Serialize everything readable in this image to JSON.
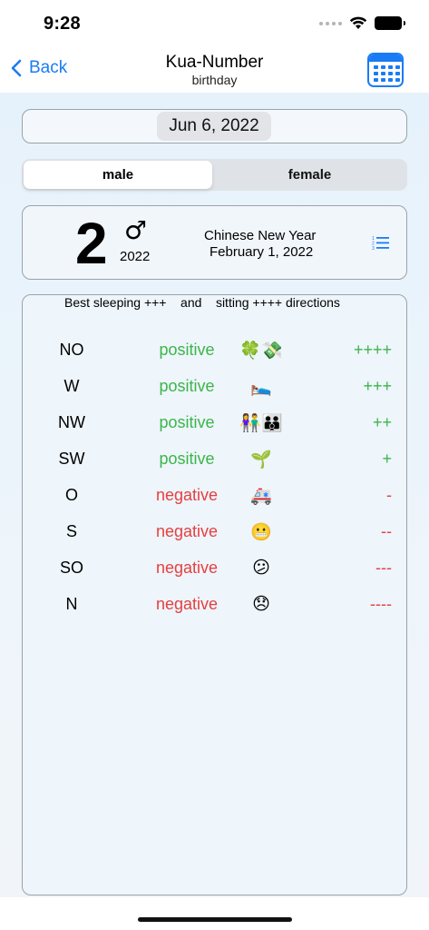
{
  "status": {
    "time": "9:28"
  },
  "nav": {
    "back_label": "Back",
    "title": "Kua-Number",
    "subtitle": "birthday"
  },
  "date_picker": {
    "value": "Jun 6, 2022"
  },
  "gender_selector": {
    "options": [
      "male",
      "female"
    ],
    "selected": "male"
  },
  "kua": {
    "number": "2",
    "gender_symbol": "♂",
    "year": "2022",
    "cny_label": "Chinese New Year",
    "cny_date": "February 1, 2022"
  },
  "directions": {
    "header": "Best sleeping +++    and    sitting ++++ directions",
    "rows": [
      {
        "code": "NO",
        "type": "positive",
        "emoji": "🍀💸",
        "rating": "++++"
      },
      {
        "code": "W",
        "type": "positive",
        "emoji": "🛌",
        "rating": "+++"
      },
      {
        "code": "NW",
        "type": "positive",
        "emoji": "👫👪",
        "rating": "++"
      },
      {
        "code": "SW",
        "type": "positive",
        "emoji": "🌱",
        "rating": "+"
      },
      {
        "code": "O",
        "type": "negative",
        "emoji": "🚑",
        "rating": "-"
      },
      {
        "code": "S",
        "type": "negative",
        "emoji": "😬",
        "rating": "--"
      },
      {
        "code": "SO",
        "type": "negative",
        "emoji": "😕",
        "rating": "---"
      },
      {
        "code": "N",
        "type": "negative",
        "emoji": "😞",
        "rating": "----"
      }
    ]
  },
  "colors": {
    "accent": "#1a7cf4",
    "positive": "#3cb54a",
    "negative": "#e64040"
  },
  "icons": [
    "chevron-left-icon",
    "calendar-icon",
    "list-icon",
    "wifi-icon",
    "battery-icon"
  ]
}
